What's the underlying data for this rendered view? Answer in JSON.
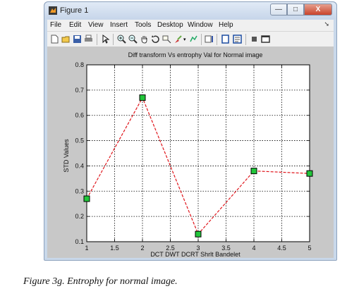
{
  "window": {
    "title": "Figure 1",
    "buttons": {
      "minimize": "—",
      "maximize": "□",
      "close": "X"
    }
  },
  "menu": [
    "File",
    "Edit",
    "View",
    "Insert",
    "Tools",
    "Desktop",
    "Window",
    "Help"
  ],
  "toolbar_icons": [
    "new-figure-icon",
    "open-icon",
    "save-icon",
    "print-icon",
    "pointer-icon",
    "zoom-in-icon",
    "zoom-out-icon",
    "pan-icon",
    "rotate-icon",
    "data-cursor-icon",
    "brush-icon",
    "link-icon",
    "colorbar-icon",
    "legend-icon",
    "hide-tools-icon",
    "show-tools-icon"
  ],
  "chart_data": {
    "type": "line",
    "title": "Diff transform Vs entrophy Val for Normal image",
    "xlabel": "DCT DWT DCRT Shrlt Bandelet",
    "ylabel": "STD Values",
    "x": [
      1,
      2,
      3,
      4,
      5
    ],
    "series": [
      {
        "values": [
          0.27,
          0.67,
          0.13,
          0.38,
          0.37
        ]
      }
    ],
    "xlim": [
      1,
      5
    ],
    "ylim": [
      0.1,
      0.8
    ],
    "xticks": [
      "1",
      "1.5",
      "2",
      "2.5",
      "3",
      "3.5",
      "4",
      "4.5",
      "5"
    ],
    "yticks": [
      "0.1",
      "0.2",
      "0.3",
      "0.4",
      "0.5",
      "0.6",
      "0.7",
      "0.8"
    ],
    "grid": true,
    "line_color": "#e0151b",
    "marker_color": "#22c63a"
  },
  "caption": {
    "label": "Figure 3g.",
    "text": " Entrophy for normal image."
  }
}
